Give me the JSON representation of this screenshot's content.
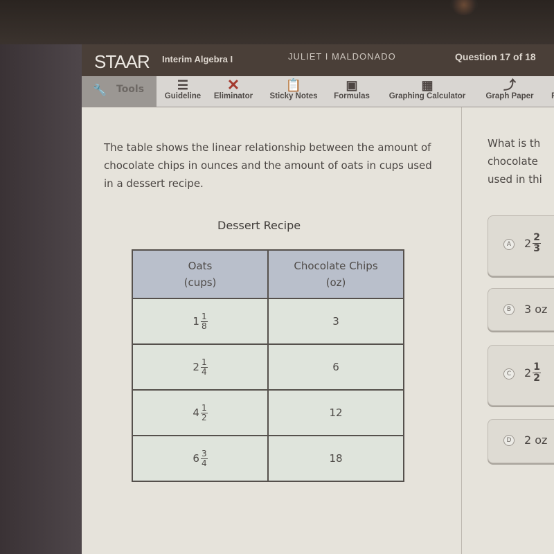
{
  "header": {
    "logo": "STAAR",
    "course": "Interim Algebra I",
    "student": "JULIET I MALDONADO",
    "question_counter": "Question 17 of 18"
  },
  "toolbar": {
    "tools_label": "Tools",
    "items": [
      {
        "label": "Guideline",
        "icon": "guideline-icon"
      },
      {
        "label": "Eliminator",
        "icon": "eliminator-x-icon"
      },
      {
        "label": "Sticky Notes",
        "icon": "sticky-note-icon"
      },
      {
        "label": "Formulas",
        "icon": "formulas-icon"
      },
      {
        "label": "Graphing Calculator",
        "icon": "calculator-icon"
      },
      {
        "label": "Graph Paper",
        "icon": "graph-line-icon"
      },
      {
        "label": "P",
        "icon": ""
      }
    ]
  },
  "question": {
    "stem": "The table shows the linear relationship between the amount of chocolate chips in ounces and the amount of oats in cups used in a dessert recipe.",
    "table_title": "Dessert Recipe",
    "columns": [
      {
        "line1": "Oats",
        "line2": "(cups)"
      },
      {
        "line1": "Chocolate Chips",
        "line2": "(oz)"
      }
    ],
    "rows": [
      {
        "oats_whole": "1",
        "oats_num": "1",
        "oats_den": "8",
        "chips": "3"
      },
      {
        "oats_whole": "2",
        "oats_num": "1",
        "oats_den": "4",
        "chips": "6"
      },
      {
        "oats_whole": "4",
        "oats_num": "1",
        "oats_den": "2",
        "chips": "12"
      },
      {
        "oats_whole": "6",
        "oats_num": "3",
        "oats_den": "4",
        "chips": "18"
      }
    ],
    "prompt_lines": [
      "What is th",
      "chocolate",
      "used in thi"
    ]
  },
  "choices": [
    {
      "letter": "A",
      "whole": "2",
      "num": "2",
      "den": "3",
      "text": ""
    },
    {
      "letter": "B",
      "whole": "",
      "num": "",
      "den": "",
      "text": "3 oz"
    },
    {
      "letter": "C",
      "whole": "2",
      "num": "1",
      "den": "2",
      "text": ""
    },
    {
      "letter": "D",
      "whole": "",
      "num": "",
      "den": "",
      "text": "2 oz"
    }
  ]
}
